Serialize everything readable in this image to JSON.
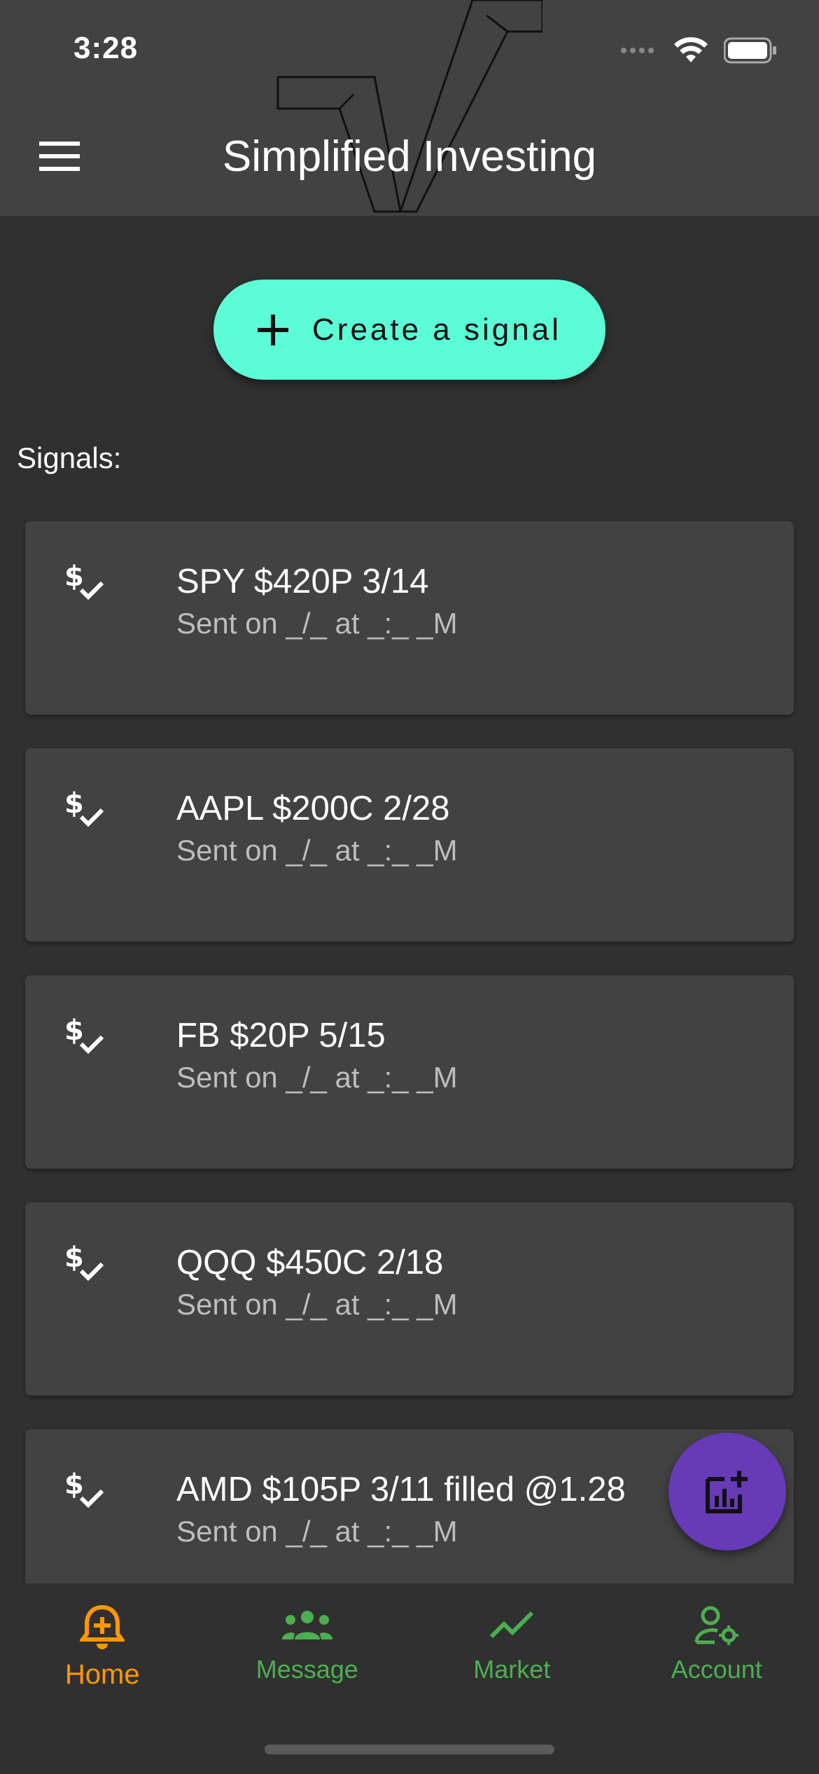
{
  "status_bar": {
    "time": "3:28"
  },
  "app_bar": {
    "title": "Simplified Investing",
    "menu_icon": "menu-icon"
  },
  "create_button": {
    "label": "Create a signal",
    "icon": "plus-icon"
  },
  "signals_heading": "Signals:",
  "signals": [
    {
      "title": "SPY $420P 3/14",
      "subtitle": "Sent on _/_ at _:_ _M"
    },
    {
      "title": "AAPL $200C 2/28",
      "subtitle": "Sent on _/_ at _:_ _M"
    },
    {
      "title": "FB $20P 5/15",
      "subtitle": "Sent on _/_ at _:_ _M"
    },
    {
      "title": "QQQ $450C 2/18",
      "subtitle": "Sent on _/_ at _:_ _M"
    },
    {
      "title": "AMD $105P 3/11 filled @1.28",
      "subtitle": "Sent on _/_ at _:_ _M"
    }
  ],
  "fab": {
    "icon": "add-chart-icon"
  },
  "bottom_nav": {
    "items": [
      {
        "label": "Home",
        "icon": "bell-plus-icon",
        "active": true
      },
      {
        "label": "Message",
        "icon": "people-icon",
        "active": false
      },
      {
        "label": "Market",
        "icon": "trending-up-icon",
        "active": false
      },
      {
        "label": "Account",
        "icon": "user-settings-icon",
        "active": false
      }
    ]
  },
  "colors": {
    "background": "#303030",
    "app_bar": "#424242",
    "card": "#424242",
    "accent_teal": "#5cfcd7",
    "fab": "#673ab7",
    "nav_active": "#ff9800",
    "nav_inactive": "#4caf50"
  }
}
